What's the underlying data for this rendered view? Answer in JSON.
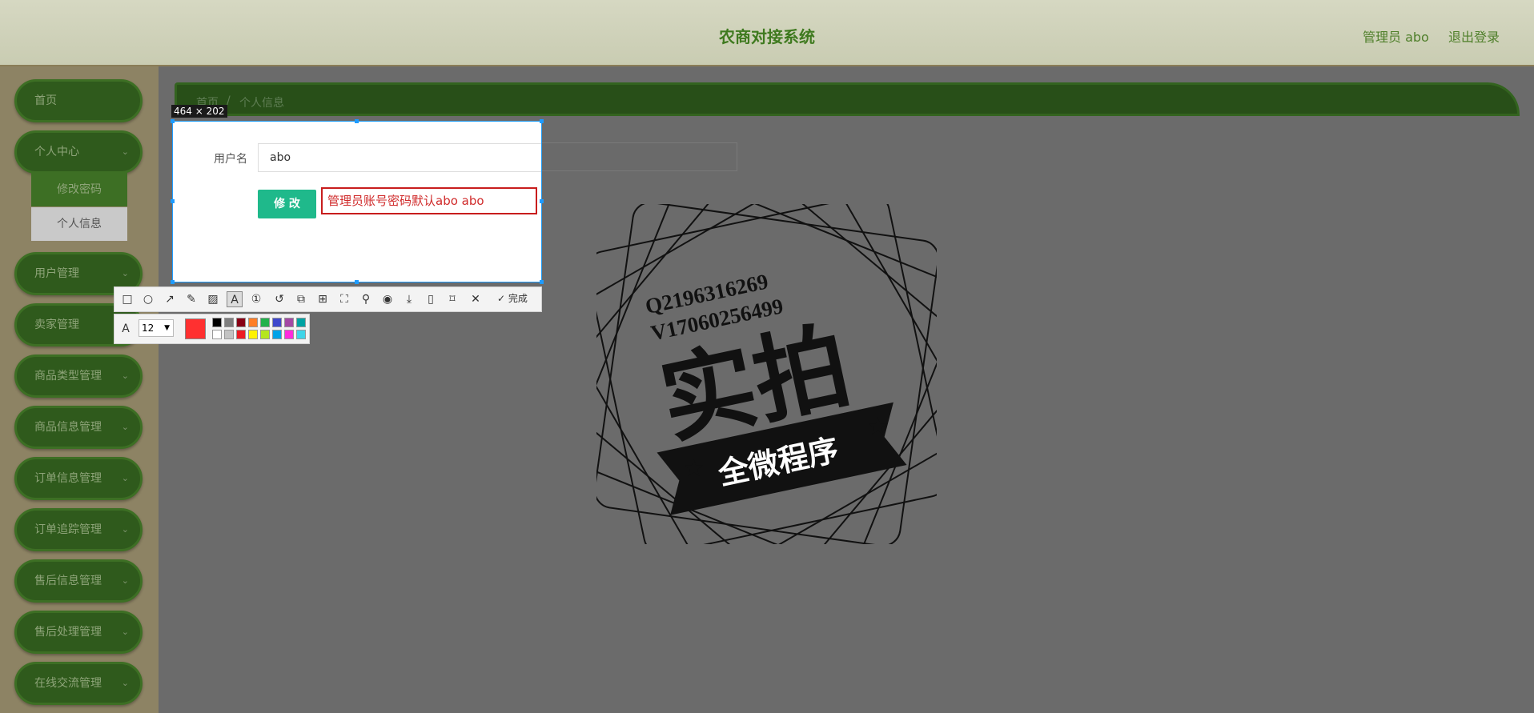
{
  "header": {
    "title": "农商对接系统",
    "user": "管理员 abo",
    "logout": "退出登录"
  },
  "sidebar": {
    "items": [
      {
        "label": "首页",
        "has_chevron": false
      },
      {
        "label": "个人中心",
        "has_chevron": true
      },
      {
        "label": "用户管理",
        "has_chevron": true
      },
      {
        "label": "卖家管理",
        "has_chevron": true
      },
      {
        "label": "商品类型管理",
        "has_chevron": true
      },
      {
        "label": "商品信息管理",
        "has_chevron": true
      },
      {
        "label": "订单信息管理",
        "has_chevron": true
      },
      {
        "label": "订单追踪管理",
        "has_chevron": true
      },
      {
        "label": "售后信息管理",
        "has_chevron": true
      },
      {
        "label": "售后处理管理",
        "has_chevron": true
      },
      {
        "label": "在线交流管理",
        "has_chevron": true
      }
    ],
    "submenu": [
      {
        "label": "修改密码",
        "selected": false
      },
      {
        "label": "个人信息",
        "selected": true
      }
    ]
  },
  "breadcrumb": [
    "首页",
    "/",
    "个人信息"
  ],
  "form": {
    "username_label": "用户名",
    "username_value": "abo",
    "submit_label": "修 改"
  },
  "screenshot_tool": {
    "size_label": "464 × 202",
    "annotation_text": "管理员账号密码默认abo abo",
    "done_label": "完成",
    "font_size": "12",
    "current_color": "#ff3030",
    "tools": [
      "rectangle-icon",
      "ellipse-icon",
      "arrow-icon",
      "pencil-icon",
      "mosaic-icon",
      "text-icon",
      "number-marker-icon",
      "undo-icon",
      "ocr-icon",
      "translate-icon",
      "long-screenshot-icon",
      "pin-icon",
      "record-icon",
      "download-icon",
      "copy-icon",
      "bookmark-icon",
      "close-icon",
      "confirm-icon"
    ],
    "palette_top": [
      "#000000",
      "#7f7f7f",
      "#880015",
      "#ff7f27",
      "#22b14c",
      "#3f48cc",
      "#a349a4",
      "#00a2a2"
    ],
    "palette_bottom": [
      "#ffffff",
      "#c3c3c3",
      "#ed1c24",
      "#fff200",
      "#b5e61d",
      "#00a2e8",
      "#ff2bdc",
      "#3fd5e8"
    ]
  },
  "watermark": {
    "line1": "Q2196316269",
    "line2": "V17060256499",
    "main": "实拍",
    "ribbon": "全微程序"
  }
}
